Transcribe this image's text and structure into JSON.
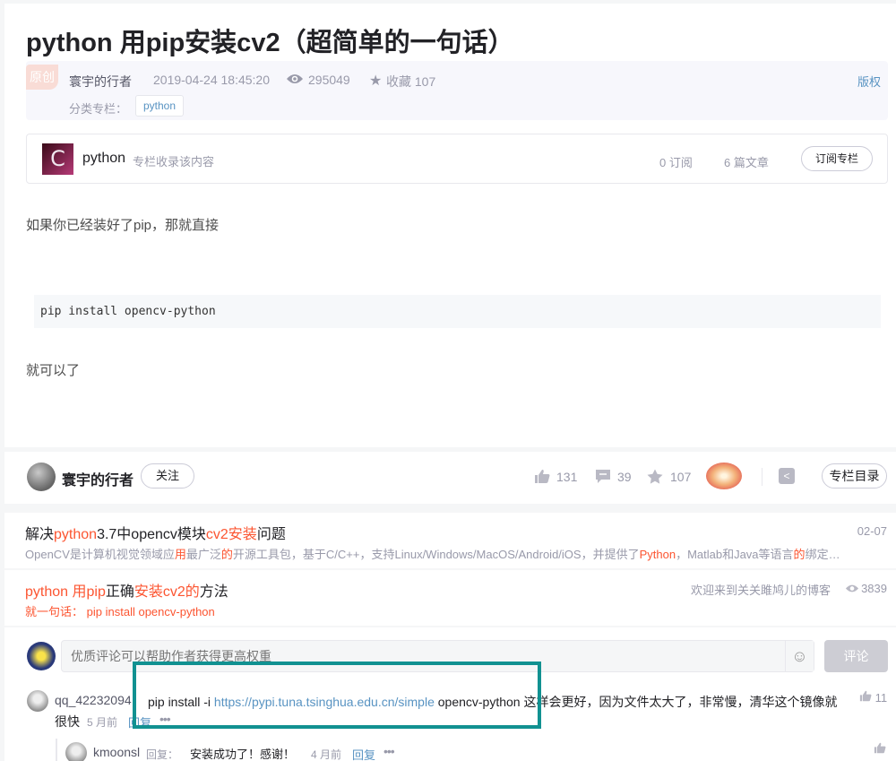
{
  "article": {
    "title": "python 用pip安装cv2（超简单的一句话）",
    "badge": "原创",
    "author": "寰宇的行者",
    "datetime": "2019-04-24 18:45:20",
    "views": "295049",
    "favorites": "收藏 107",
    "copyright": "版权",
    "category_label": "分类专栏：",
    "category_tag": "python"
  },
  "column": {
    "logo_letter": "C",
    "name": "python",
    "desc": "专栏收录该内容",
    "subs": "0 订阅",
    "articles": "6 篇文章",
    "subscribe_btn": "订阅专栏"
  },
  "content": {
    "para1": "如果你已经装好了pip，那就直接",
    "code": "pip install opencv-python",
    "para2": "就可以了"
  },
  "author_bar": {
    "name": "寰宇的行者",
    "follow": "关注",
    "likes": "131",
    "comments": "39",
    "favs": "107",
    "toc": "专栏目录"
  },
  "recommend": [
    {
      "title_parts": [
        "解决",
        "python",
        "3.7中opencv模块",
        "cv2安装",
        "问题"
      ],
      "desc_parts": [
        "OpenCV是计算机视觉领域应",
        "用",
        "最广泛",
        "的",
        "开源工具包，基于C/C++，支持Linux/Windows/MacOS/Android/iOS，并提供了",
        "Python",
        "，Matlab和Java等语言",
        "的",
        "绑定…"
      ],
      "date": "02-07"
    },
    {
      "title_parts": [
        "python 用pip",
        "正确",
        "安装cv2的",
        "方法"
      ],
      "desc_parts": [
        "就",
        "一句话",
        "： ",
        "pip",
        " install opencv-",
        "python"
      ],
      "source": "欢迎来到关关雎鸠儿的博客",
      "views": "3839"
    }
  ],
  "comments": {
    "placeholder": "优质评论可以帮助作者获得更高权重",
    "emoji": "☺",
    "submit": "评论",
    "items": [
      {
        "user": "qq_42232094",
        "text_pre": "pip install -i ",
        "link": "https://pypi.tuna.tsinghua.edu.cn/simple",
        "text_post": " opencv-python 这样会更好，因为文件太大了，非常慢，清华这个镜像就",
        "text_line2": "很快",
        "time": "5 月前",
        "reply": "回复",
        "likes": "11"
      },
      {
        "user": "kmoonsl",
        "reply_label": "回复：",
        "text": "安装成功了！感谢！",
        "time": "4 月前",
        "reply": "回复"
      }
    ]
  },
  "colors": {
    "accent": "#fc5531",
    "link": "#5893c2",
    "highlight_box": "#119191"
  }
}
